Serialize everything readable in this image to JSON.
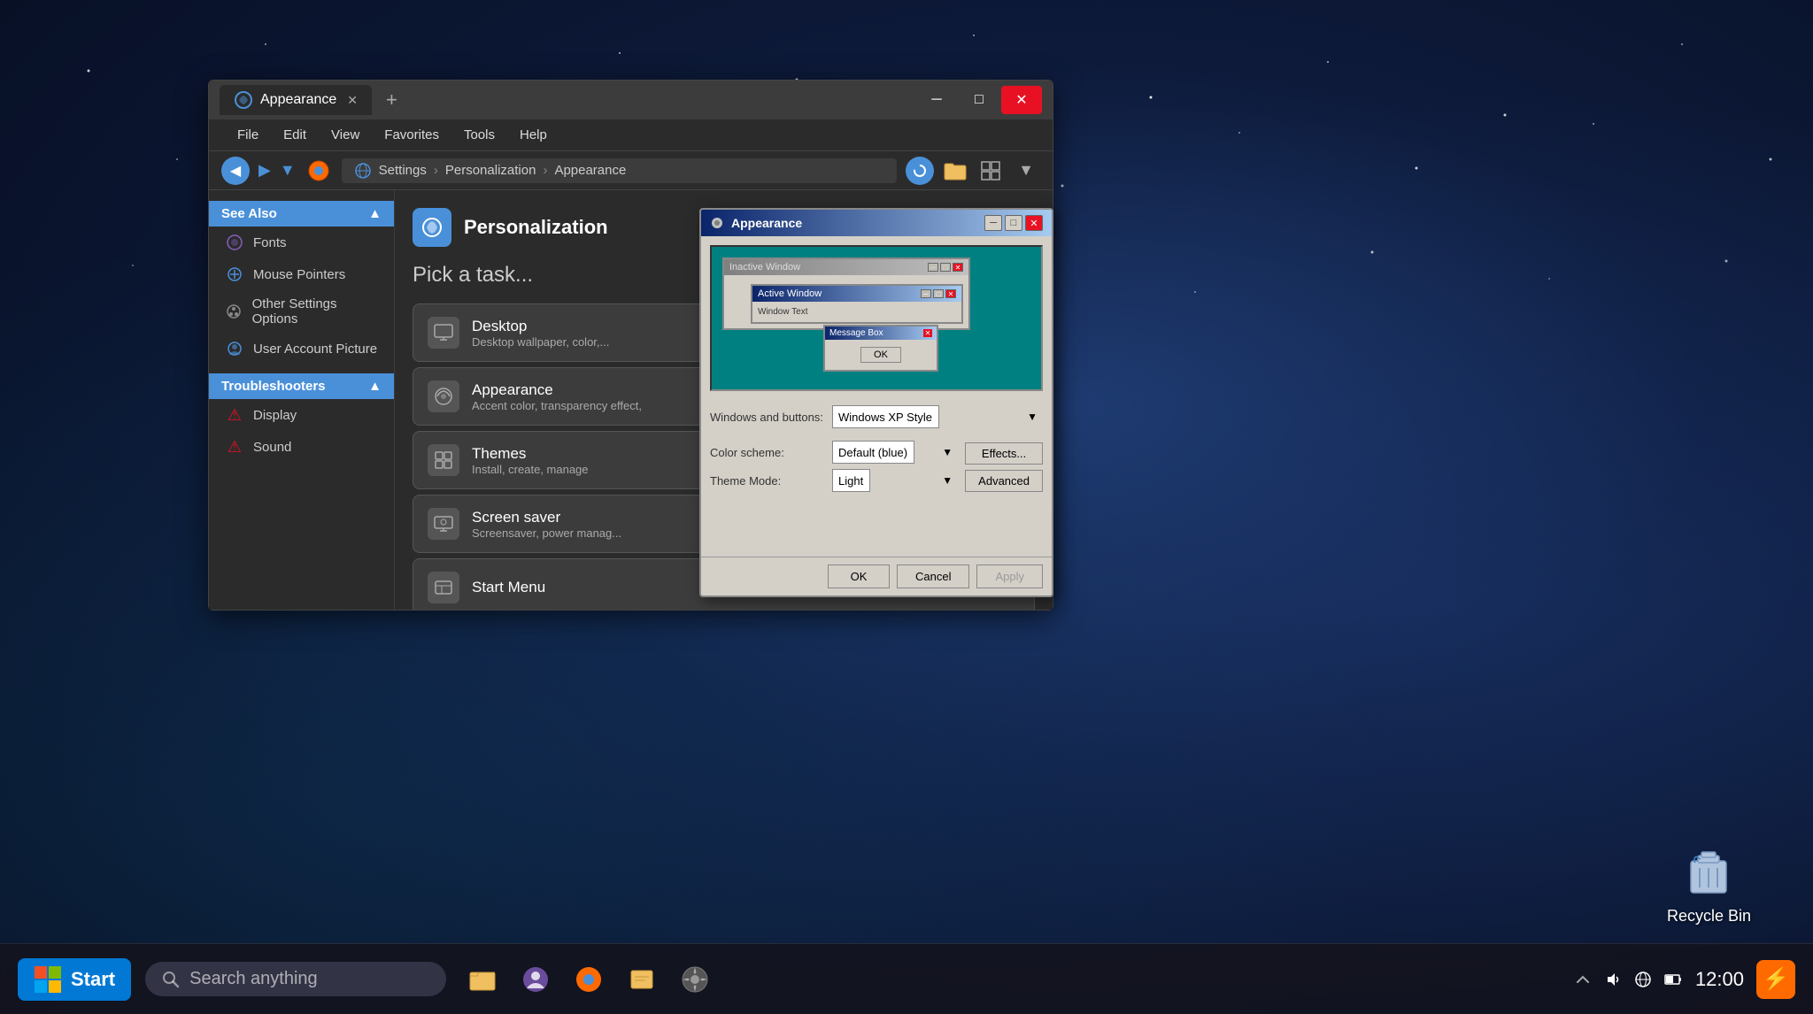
{
  "desktop": {
    "recycle_bin_label": "Recycle Bin"
  },
  "taskbar": {
    "start_label": "Start",
    "search_placeholder": "Search anything",
    "time": "12:00"
  },
  "explorer": {
    "tab_title": "Appearance",
    "menu": {
      "file": "File",
      "edit": "Edit",
      "view": "View",
      "favorites": "Favorites",
      "tools": "Tools",
      "help": "Help"
    },
    "address": {
      "back": "Back",
      "settings": "Settings",
      "personalization": "Personalization",
      "appearance": "Appearance"
    },
    "sidebar": {
      "see_also_label": "See Also",
      "items": [
        {
          "label": "Fonts",
          "icon": "🎨"
        },
        {
          "label": "Mouse Pointers",
          "icon": "🖱️"
        },
        {
          "label": "Other Settings Options",
          "icon": "🌙"
        },
        {
          "label": "User Account Picture",
          "icon": "👤"
        }
      ],
      "troubleshooters_label": "Troubleshooters",
      "trouble_items": [
        {
          "label": "Display"
        },
        {
          "label": "Sound"
        }
      ]
    },
    "panel": {
      "header_title": "Personalization",
      "pick_task": "Pick a task...",
      "tasks": [
        {
          "name": "Desktop",
          "desc": "Desktop wallpaper, color,..."
        },
        {
          "name": "Appearance",
          "desc": "Accent color, transparency effect,"
        },
        {
          "name": "Themes",
          "desc": "Install, create, manage"
        },
        {
          "name": "Screen saver",
          "desc": "Screensaver, power manag..."
        },
        {
          "name": "Start Menu",
          "desc": ""
        }
      ]
    }
  },
  "appearance_dialog": {
    "title": "Appearance",
    "preview": {
      "inactive_window": "Inactive Window",
      "active_window": "Active Window",
      "window_text": "Window Text",
      "message_box": "Message Box",
      "ok_label": "OK"
    },
    "windows_buttons_label": "Windows and buttons:",
    "windows_buttons_value": "Windows XP Style",
    "color_scheme_label": "Color scheme:",
    "color_scheme_value": "Default (blue)",
    "theme_mode_label": "Theme Mode:",
    "theme_mode_value": "Light",
    "effects_btn": "Effects...",
    "advanced_btn": "Advanced",
    "ok_btn": "OK",
    "cancel_btn": "Cancel",
    "apply_btn": "Apply"
  }
}
